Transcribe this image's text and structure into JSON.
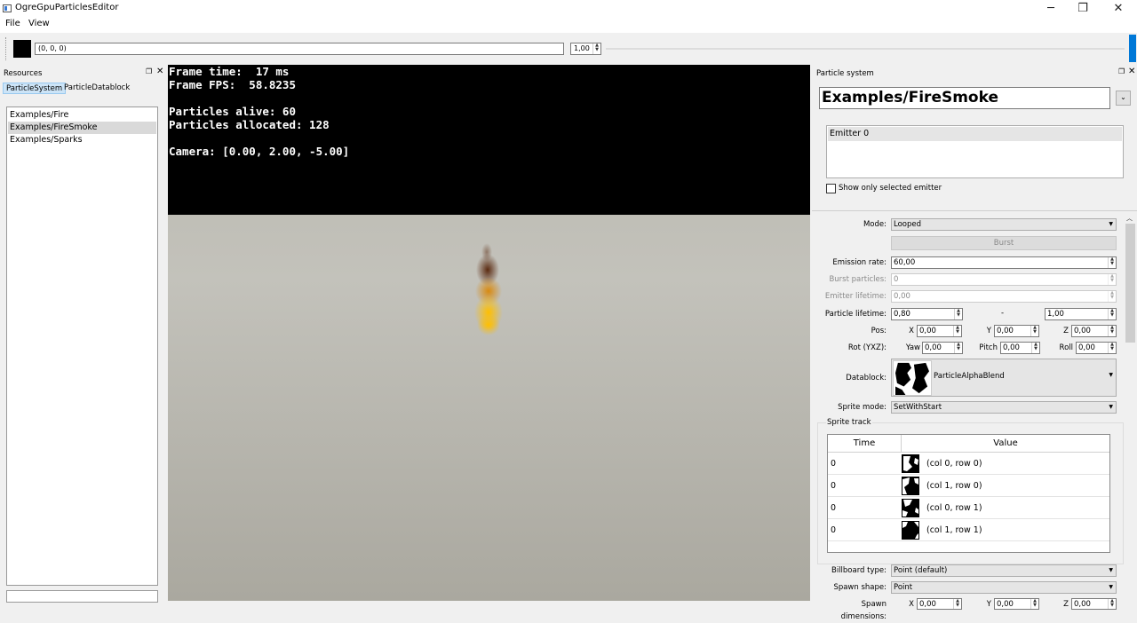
{
  "window": {
    "title": "OgreGpuParticlesEditor",
    "minimize": "─",
    "maximize": "❐",
    "close": "✕"
  },
  "menu": {
    "file": "File",
    "view": "View"
  },
  "toolbar": {
    "color_value": "(0, 0, 0)",
    "scale_value": "1,00",
    "swatch_color": "#000000",
    "accent": "#0078d7"
  },
  "resources": {
    "title": "Resources",
    "tabs": [
      "ParticleSystem",
      "ParticleDatablock"
    ],
    "items": [
      "Examples/Fire",
      "Examples/FireSmoke",
      "Examples/Sparks"
    ],
    "selected_index": 1
  },
  "viewport": {
    "frame_time": "Frame time:  17 ms",
    "frame_fps": "Frame FPS:  58.8235",
    "particles_alive": "Particles alive: 60",
    "particles_allocated": "Particles allocated: 128",
    "camera": "Camera: [0.00, 2.00, -5.00]"
  },
  "particle_system": {
    "title": "Particle system",
    "name": "Examples/FireSmoke",
    "emitters": [
      "Emitter 0"
    ],
    "show_only_selected": "Show only selected emitter",
    "mode": {
      "label": "Mode:",
      "value": "Looped"
    },
    "burst_button": "Burst",
    "emission_rate": {
      "label": "Emission rate:",
      "value": "60,00"
    },
    "burst_particles": {
      "label": "Burst particles:",
      "value": "0"
    },
    "emitter_lifetime": {
      "label": "Emitter lifetime:",
      "value": "0,00"
    },
    "particle_lifetime": {
      "label": "Particle lifetime:",
      "min": "0,80",
      "sep": "-",
      "max": "1,00"
    },
    "pos": {
      "label": "Pos:",
      "x_label": "X",
      "x": "0,00",
      "y_label": "Y",
      "y": "0,00",
      "z_label": "Z",
      "z": "0,00"
    },
    "rot": {
      "label": "Rot (YXZ):",
      "yaw_label": "Yaw",
      "yaw": "0,00",
      "pitch_label": "Pitch",
      "pitch": "0,00",
      "roll_label": "Roll",
      "roll": "0,00"
    },
    "datablock": {
      "label": "Datablock:",
      "value": "ParticleAlphaBlend"
    },
    "sprite_mode": {
      "label": "Sprite mode:",
      "value": "SetWithStart"
    },
    "sprite_track": {
      "title": "Sprite track",
      "columns": [
        "Time",
        "Value"
      ],
      "rows": [
        {
          "time": "0",
          "value": "(col 0, row 0)"
        },
        {
          "time": "0",
          "value": "(col 1, row 0)"
        },
        {
          "time": "0",
          "value": "(col 0, row 1)"
        },
        {
          "time": "0",
          "value": "(col 1, row 1)"
        }
      ]
    },
    "billboard_type": {
      "label": "Billboard type:",
      "value": "Point (default)"
    },
    "spawn_shape": {
      "label": "Spawn shape:",
      "value": "Point"
    },
    "spawn_dimensions": {
      "label": "Spawn dimensions:",
      "x_label": "X",
      "x": "0,00",
      "y_label": "Y",
      "y": "0,00",
      "z_label": "Z",
      "z": "0,00"
    }
  }
}
